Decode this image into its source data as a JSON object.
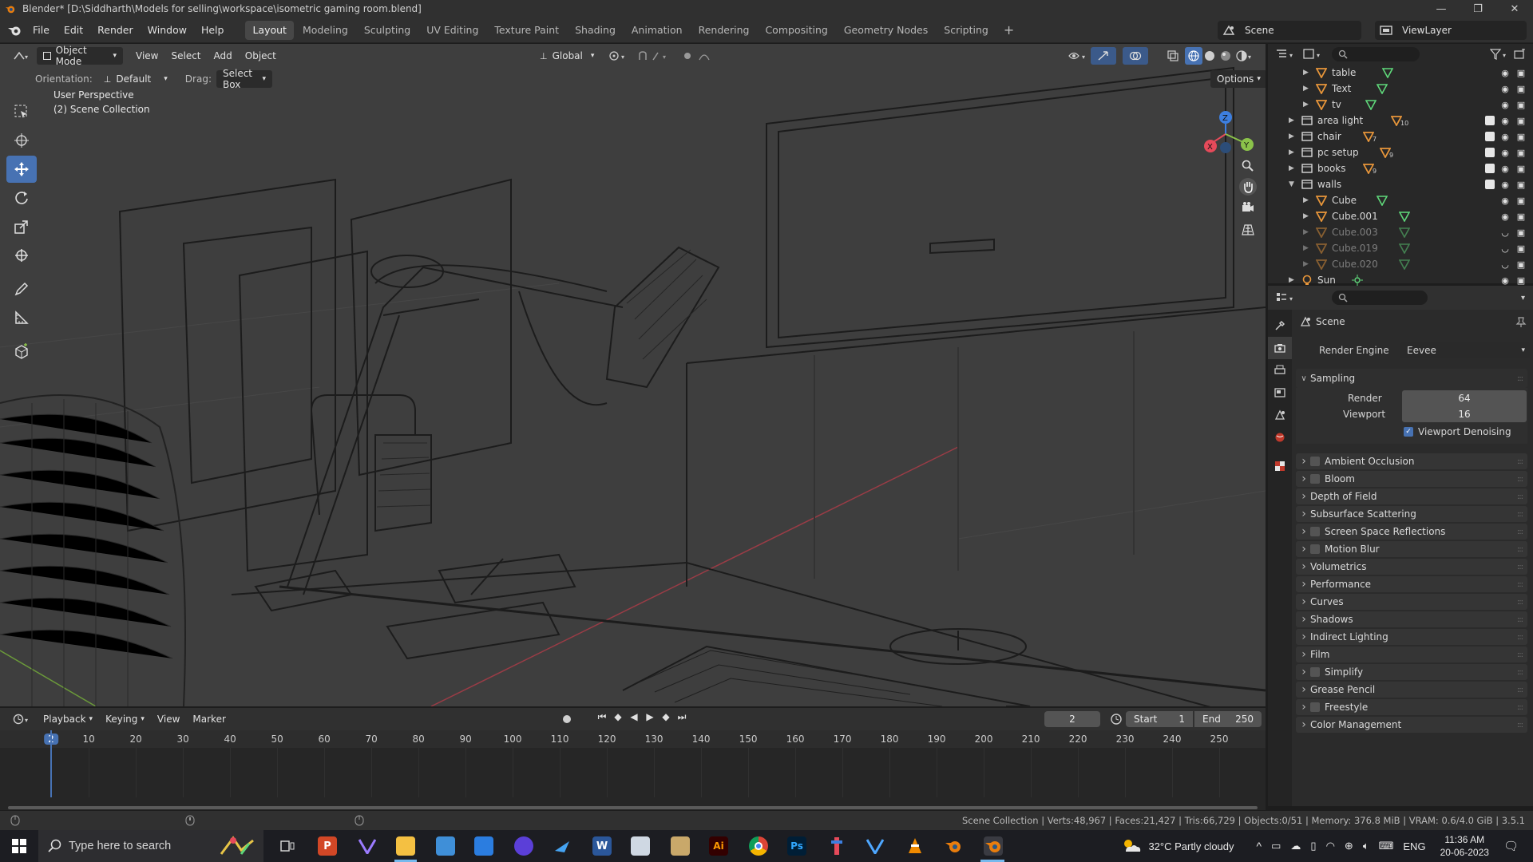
{
  "window": {
    "title": "Blender* [D:\\Siddharth\\Models for selling\\workspace\\isometric gaming room.blend]",
    "controls": [
      "—",
      "❐",
      "✕"
    ]
  },
  "menu": [
    "File",
    "Edit",
    "Render",
    "Window",
    "Help"
  ],
  "workspaces": [
    "Layout",
    "Modeling",
    "Sculpting",
    "UV Editing",
    "Texture Paint",
    "Shading",
    "Animation",
    "Rendering",
    "Compositing",
    "Geometry Nodes",
    "Scripting"
  ],
  "active_workspace": "Layout",
  "scene": "Scene",
  "view_layer": "ViewLayer",
  "viewport": {
    "mode": "Object Mode",
    "menus": [
      "View",
      "Select",
      "Add",
      "Object"
    ],
    "transform_orientation": "Global",
    "orientation_label": "Orientation:",
    "orientation_value": "Default",
    "drag_label": "Drag:",
    "drag_value": "Select Box",
    "options": "Options",
    "perspective": "User Perspective",
    "collection": "(2) Scene Collection",
    "gizmo_axes": [
      "X",
      "Y",
      "Z"
    ]
  },
  "tools": [
    "select-box",
    "cursor",
    "move",
    "rotate",
    "scale",
    "transform",
    "annotate",
    "measure",
    "add-cube"
  ],
  "timeline": {
    "menus": [
      "Playback",
      "Keying",
      "View",
      "Marker"
    ],
    "current_frame": "2",
    "start_label": "Start",
    "start": "1",
    "end_label": "End",
    "end": "250",
    "ticks": [
      "2",
      "10",
      "20",
      "30",
      "40",
      "50",
      "60",
      "70",
      "80",
      "90",
      "100",
      "110",
      "120",
      "130",
      "140",
      "150",
      "160",
      "170",
      "180",
      "190",
      "200",
      "210",
      "220",
      "230",
      "240",
      "250"
    ]
  },
  "outliner": {
    "rows": [
      {
        "label": "table",
        "kind": "mesh",
        "indent": 2,
        "dim": false,
        "visible": true
      },
      {
        "label": "Text",
        "kind": "mesh",
        "indent": 2,
        "dim": false,
        "visible": true
      },
      {
        "label": "tv",
        "kind": "mesh",
        "indent": 2,
        "dim": false,
        "visible": true
      },
      {
        "label": "area light",
        "kind": "collection",
        "indent": 1,
        "dim": false,
        "visible": true,
        "badge": "10"
      },
      {
        "label": "chair",
        "kind": "collection",
        "indent": 1,
        "dim": false,
        "visible": true,
        "badge": "7"
      },
      {
        "label": "pc setup",
        "kind": "collection",
        "indent": 1,
        "dim": false,
        "visible": true,
        "badge": "9"
      },
      {
        "label": "books",
        "kind": "collection",
        "indent": 1,
        "dim": false,
        "visible": true,
        "badge": "9"
      },
      {
        "label": "walls",
        "kind": "collection",
        "indent": 1,
        "dim": false,
        "visible": true
      },
      {
        "label": "Cube",
        "kind": "mesh",
        "indent": 2,
        "dim": false,
        "visible": true
      },
      {
        "label": "Cube.001",
        "kind": "mesh",
        "indent": 2,
        "dim": false,
        "visible": true
      },
      {
        "label": "Cube.003",
        "kind": "mesh",
        "indent": 2,
        "dim": true,
        "visible": false
      },
      {
        "label": "Cube.019",
        "kind": "mesh",
        "indent": 2,
        "dim": true,
        "visible": false
      },
      {
        "label": "Cube.020",
        "kind": "mesh",
        "indent": 2,
        "dim": true,
        "visible": false
      },
      {
        "label": "Sun",
        "kind": "light",
        "indent": 1,
        "dim": false,
        "visible": true
      }
    ]
  },
  "properties": {
    "context": "Scene",
    "render_engine_label": "Render Engine",
    "render_engine": "Eevee",
    "sampling": {
      "title": "Sampling",
      "render_label": "Render",
      "render": "64",
      "viewport_label": "Viewport",
      "viewport": "16",
      "denoise_label": "Viewport Denoising"
    },
    "sections": [
      {
        "label": "Ambient Occlusion",
        "checkbox": true
      },
      {
        "label": "Bloom",
        "checkbox": true
      },
      {
        "label": "Depth of Field",
        "checkbox": false
      },
      {
        "label": "Subsurface Scattering",
        "checkbox": false
      },
      {
        "label": "Screen Space Reflections",
        "checkbox": true
      },
      {
        "label": "Motion Blur",
        "checkbox": true
      },
      {
        "label": "Volumetrics",
        "checkbox": false
      },
      {
        "label": "Performance",
        "checkbox": false
      },
      {
        "label": "Curves",
        "checkbox": false
      },
      {
        "label": "Shadows",
        "checkbox": false
      },
      {
        "label": "Indirect Lighting",
        "checkbox": false
      },
      {
        "label": "Film",
        "checkbox": false
      },
      {
        "label": "Simplify",
        "checkbox": true
      },
      {
        "label": "Grease Pencil",
        "checkbox": false
      },
      {
        "label": "Freestyle",
        "checkbox": true
      },
      {
        "label": "Color Management",
        "checkbox": false
      }
    ]
  },
  "statusbar": "Scene Collection | Verts:48,967 | Faces:21,427 | Tris:66,729 | Objects:0/51 | Memory: 376.8 MiB | VRAM: 0.6/4.0 GiB | 3.5.1",
  "taskbar": {
    "search_placeholder": "Type here to search",
    "weather": "32°C  Partly cloudy",
    "language": "ENG",
    "time": "11:36 AM",
    "date": "20-06-2023"
  },
  "colors": {
    "accent": "#4772b3",
    "mesh_icon": "#e8963a",
    "mesh_data": "#5fd87a",
    "axis_x": "#e64a5a",
    "axis_y": "#8bc34a",
    "axis_z": "#3d7fe0"
  }
}
